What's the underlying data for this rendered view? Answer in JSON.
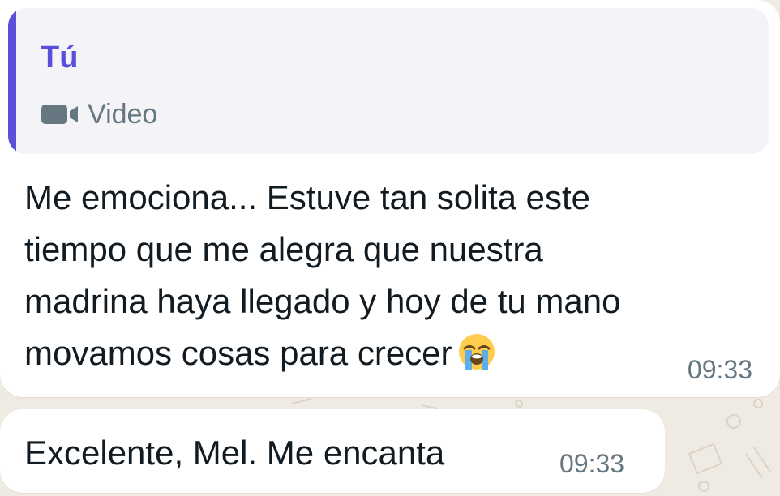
{
  "messages": [
    {
      "quote": {
        "author": "Tú",
        "type_icon": "video-camera-icon",
        "type_label": "Video"
      },
      "lines": [
        "Me emociona... Estuve tan solita este",
        "tiempo que me alegra que nuestra",
        "madrina haya llegado y hoy de tu mano",
        "movamos cosas para crecer"
      ],
      "emoji": "loudly-crying-face-icon",
      "time": "09:33"
    },
    {
      "text": "Excelente, Mel. Me encanta",
      "time": "09:33"
    }
  ],
  "colors": {
    "accent": "#5a4fd8",
    "background": "#efeae2",
    "bubble": "#ffffff",
    "quote_bg": "#f4f3f7",
    "meta_text": "#667781"
  }
}
